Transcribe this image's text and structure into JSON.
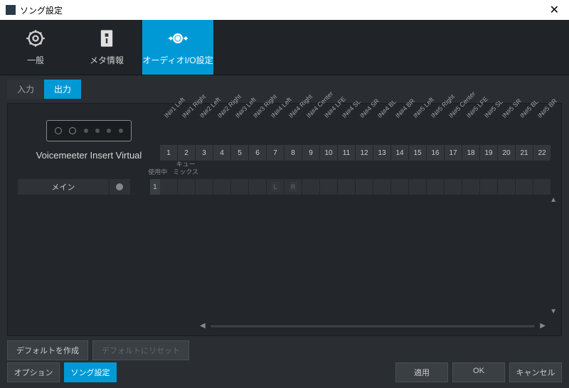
{
  "window": {
    "title": "ソング設定"
  },
  "tabs": [
    {
      "label": "一般"
    },
    {
      "label": "メタ情報"
    },
    {
      "label": "オーディオI/O設定"
    }
  ],
  "subtabs": {
    "input": "入力",
    "output": "出力"
  },
  "device": {
    "name": "Voicemeeter Insert Virtual"
  },
  "columns": {
    "use": "使用中",
    "cue": "キュー\nミックス"
  },
  "track": {
    "name": "メイン",
    "num": "1",
    "assign_l": "L",
    "assign_r": "R"
  },
  "channels": [
    {
      "n": "1",
      "label": "IN#1 Left"
    },
    {
      "n": "2",
      "label": "IN#1 Right"
    },
    {
      "n": "3",
      "label": "IN#2 Left"
    },
    {
      "n": "4",
      "label": "IN#2 Right"
    },
    {
      "n": "5",
      "label": "IN#3 Left"
    },
    {
      "n": "6",
      "label": "IN#3 Right"
    },
    {
      "n": "7",
      "label": "IN#4 Left"
    },
    {
      "n": "8",
      "label": "IN#4 Right"
    },
    {
      "n": "9",
      "label": "IN#4 Center"
    },
    {
      "n": "10",
      "label": "IN#4 LFE"
    },
    {
      "n": "11",
      "label": "IN#4 SL"
    },
    {
      "n": "12",
      "label": "IN#4 SR"
    },
    {
      "n": "13",
      "label": "IN#4 BL"
    },
    {
      "n": "14",
      "label": "IN#4 BR"
    },
    {
      "n": "15",
      "label": "IN#5 Left"
    },
    {
      "n": "16",
      "label": "IN#5 Right"
    },
    {
      "n": "17",
      "label": "IN#5 Center"
    },
    {
      "n": "18",
      "label": "IN#5 LFE"
    },
    {
      "n": "19",
      "label": "IN#5 SL"
    },
    {
      "n": "20",
      "label": "IN#5 SR"
    },
    {
      "n": "21",
      "label": "IN#5 BL"
    },
    {
      "n": "22",
      "label": "IN#5 BR"
    }
  ],
  "buttons": {
    "create_default": "デフォルトを作成",
    "reset_default": "デフォルトにリセット",
    "options": "オプション",
    "song_settings": "ソング設定",
    "apply": "適用",
    "ok": "OK",
    "cancel": "キャンセル"
  }
}
